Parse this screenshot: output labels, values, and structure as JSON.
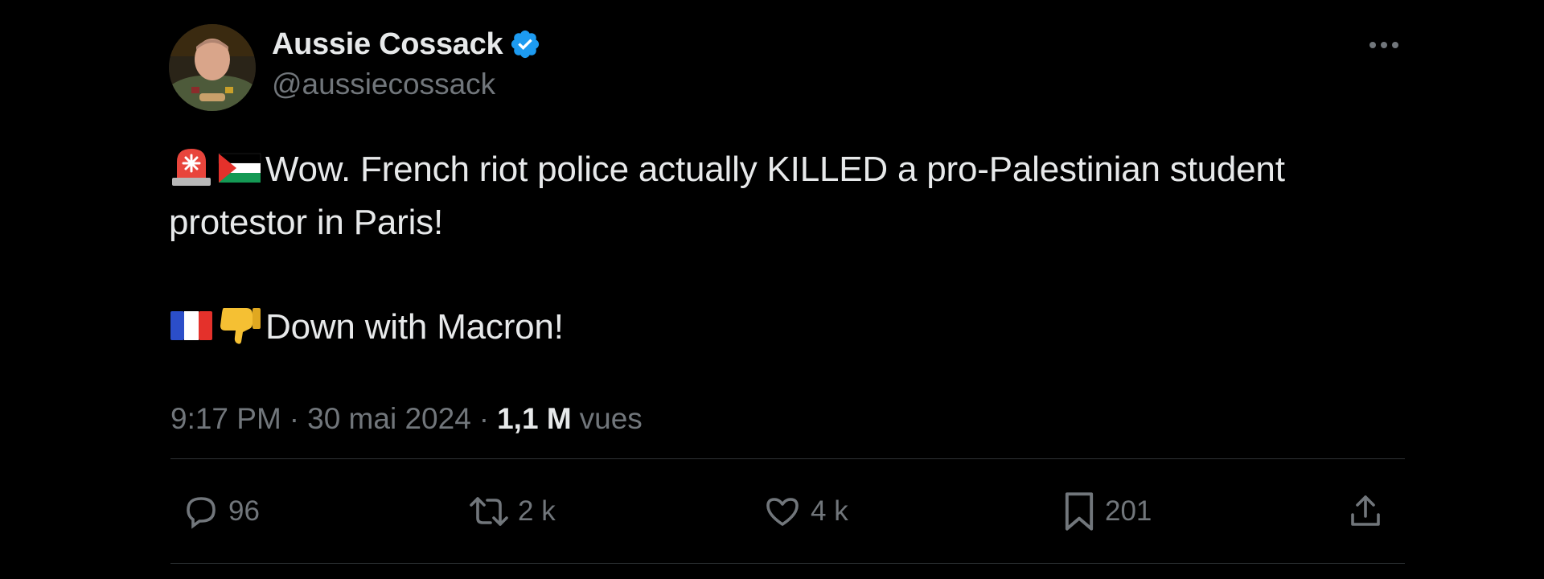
{
  "author": {
    "display_name": "Aussie Cossack",
    "handle": "@aussiecossack",
    "verified": true,
    "verified_color": "#1d9bf0"
  },
  "tweet": {
    "line1_emojis": [
      "rotating-light-emoji",
      "palestine-flag-emoji"
    ],
    "line1_text": "Wow. French riot police actually KILLED a pro-Palestinian student protestor in Paris!",
    "line2_emojis": [
      "france-flag-emoji",
      "thumbs-down-emoji"
    ],
    "line2_text": "Down with Macron!"
  },
  "meta": {
    "time": "9:17 PM",
    "separator": "·",
    "date": "30 mai 2024",
    "views_count": "1,1 M",
    "views_label": "vues"
  },
  "actions": {
    "replies": "96",
    "reposts": "2 k",
    "likes": "4 k",
    "bookmarks": "201"
  },
  "colors": {
    "background": "#000000",
    "text_primary": "#e7e9ea",
    "text_secondary": "#71767b",
    "divider": "#2f3336"
  }
}
